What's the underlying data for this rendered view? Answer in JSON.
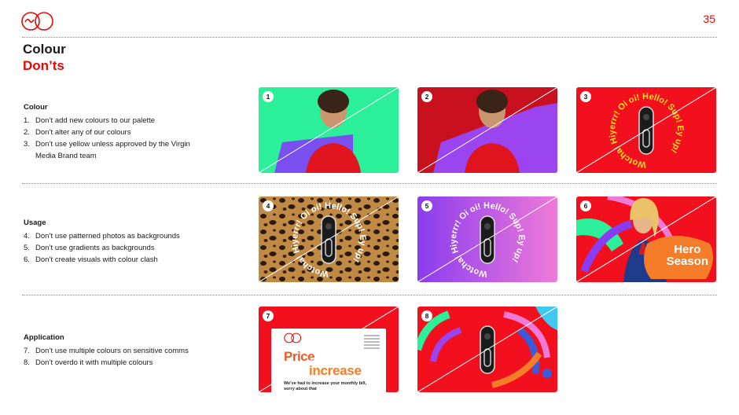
{
  "header": {
    "page_number": "35"
  },
  "title": {
    "main": "Colour",
    "sub": "Don’ts"
  },
  "sections": {
    "colour": {
      "heading": "Colour",
      "items": [
        {
          "n": "1.",
          "text": "Don’t add new colours to our palette"
        },
        {
          "n": "2.",
          "text": "Don’t alter any of our colours"
        },
        {
          "n": "3.",
          "text": "Don’t use yellow unless approved by the Virgin Media Brand team"
        }
      ]
    },
    "usage": {
      "heading": "Usage",
      "items": [
        {
          "n": "4.",
          "text": "Don’t use patterned photos as backgrounds"
        },
        {
          "n": "5.",
          "text": "Don’t use gradients as backgrounds"
        },
        {
          "n": "6.",
          "text": "Don’t create visuals with colour clash"
        }
      ]
    },
    "application": {
      "heading": "Application",
      "items": [
        {
          "n": "7.",
          "text": "Don’t use multiple colours on sensitive comms"
        },
        {
          "n": "8.",
          "text": "Don’t overdo it with multiple colours"
        }
      ]
    }
  },
  "tiles": {
    "t1": {
      "num": "1"
    },
    "t2": {
      "num": "2"
    },
    "t3": {
      "num": "3"
    },
    "t4": {
      "num": "4"
    },
    "t5": {
      "num": "5"
    },
    "t6": {
      "num": "6"
    },
    "t7": {
      "num": "7"
    },
    "t8": {
      "num": "8"
    }
  },
  "doorbell_text": {
    "ring": "Wotcha! Hiyerrr! Oi oi! Hello! Sup! Ey up!"
  },
  "tile6": {
    "line1": "Hero",
    "line2": "Season"
  },
  "tile7": {
    "price": "Price",
    "increase": "increase",
    "body": "We’ve had to increase your monthly bill, sorry about that"
  },
  "colors": {
    "brand_red": "#e10a0a",
    "green": "#2cef9a",
    "purple": "#9b45f0",
    "orange": "#f57d2a"
  }
}
